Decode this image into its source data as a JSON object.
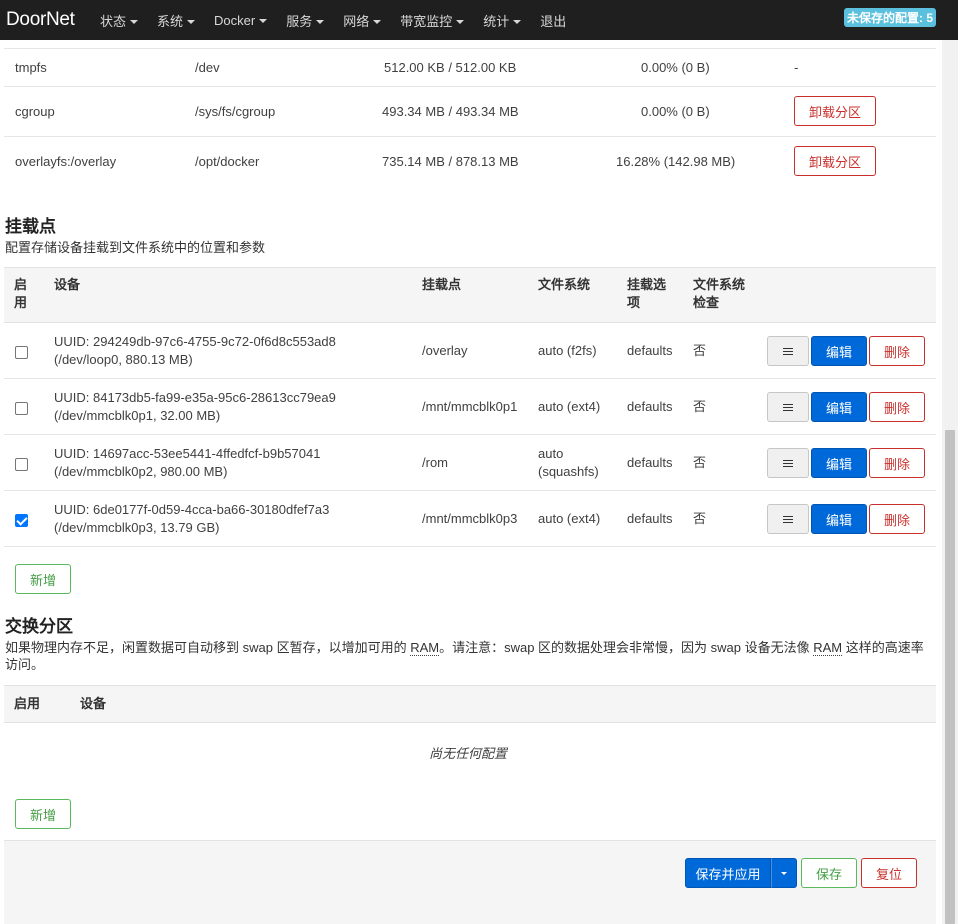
{
  "navbar": {
    "brand": "DoorNet",
    "menu": [
      "状态",
      "系统",
      "Docker",
      "服务",
      "网络",
      "带宽监控",
      "统计",
      "退出"
    ],
    "unsaved_badge": "未保存的配置: 5"
  },
  "mounted_fs": {
    "rows": [
      {
        "fs": "tmpfs",
        "mount": "/dev",
        "usage": "512.00 KB / 512.00 KB",
        "percent": "0.00% (0 B)",
        "action": "-"
      },
      {
        "fs": "cgroup",
        "mount": "/sys/fs/cgroup",
        "usage": "493.34 MB / 493.34 MB",
        "percent": "0.00% (0 B)",
        "action": "卸载分区"
      },
      {
        "fs": "overlayfs:/overlay",
        "mount": "/opt/docker",
        "usage": "735.14 MB / 878.13 MB",
        "percent": "16.28% (142.98 MB)",
        "action": "卸载分区"
      }
    ]
  },
  "mount_points": {
    "title": "挂载点",
    "description": "配置存储设备挂载到文件系统中的位置和参数",
    "headers": {
      "enabled_1": "启",
      "enabled_2": "用",
      "device": "设备",
      "mountpoint": "挂载点",
      "filesystem": "文件系统",
      "options_1": "挂载选",
      "options_2": "项",
      "fsck_1": "文件系统",
      "fsck_2": "检查"
    },
    "rows": [
      {
        "checked": false,
        "uuid": "UUID: 294249db-97c6-4755-9c72-0f6d8c553ad8",
        "dev": "(/dev/loop0, 880.13 MB)",
        "mount": "/overlay",
        "fs_1": "auto (f2fs)",
        "fs_2": "",
        "options": "defaults",
        "fsck": "否"
      },
      {
        "checked": false,
        "uuid": "UUID: 84173db5-fa99-e35a-95c6-28613cc79ea9",
        "dev": "(/dev/mmcblk0p1, 32.00 MB)",
        "mount": "/mnt/mmcblk0p1",
        "fs_1": "auto (ext4)",
        "fs_2": "",
        "options": "defaults",
        "fsck": "否"
      },
      {
        "checked": false,
        "uuid": "UUID: 14697acc-53ee5441-4ffedfcf-b9b57041",
        "dev": "(/dev/mmcblk0p2, 980.00 MB)",
        "mount": "/rom",
        "fs_1": "auto",
        "fs_2": "(squashfs)",
        "options": "defaults",
        "fsck": "否"
      },
      {
        "checked": true,
        "uuid": "UUID: 6de0177f-0d59-4cca-ba66-30180dfef7a3",
        "dev": "(/dev/mmcblk0p3, 13.79 GB)",
        "mount": "/mnt/mmcblk0p3",
        "fs_1": "auto (ext4)",
        "fs_2": "",
        "options": "defaults",
        "fsck": "否"
      }
    ],
    "edit_label": "编辑",
    "delete_label": "删除",
    "add_label": "新增"
  },
  "swap": {
    "title": "交换分区",
    "desc_part1": "如果物理内存不足，闲置数据可自动移到 swap 区暂存，以增加可用的 ",
    "desc_ram1": "RAM",
    "desc_part2": "。请注意：swap 区的数据处理会非常慢，因为 swap 设备无法像 ",
    "desc_ram2": "RAM",
    "desc_part3": " 这样的高速率",
    "desc_line2": "访问。",
    "headers": {
      "enabled": "启用",
      "device": "设备"
    },
    "empty": "尚无任何配置",
    "add_label": "新增"
  },
  "footer": {
    "save_apply": "保存并应用",
    "save": "保存",
    "reset": "复位"
  }
}
